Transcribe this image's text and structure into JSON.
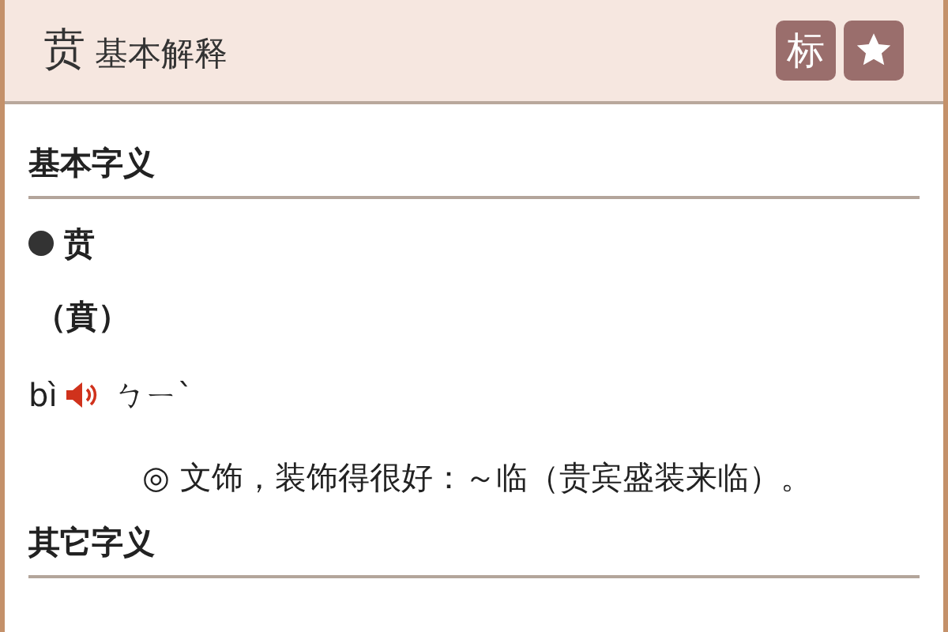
{
  "header": {
    "character": "贲",
    "title": "基本解释"
  },
  "header_buttons": [
    {
      "kind": "text",
      "label": "标"
    },
    {
      "kind": "star"
    }
  ],
  "sections": [
    {
      "heading": "基本字义",
      "entry": {
        "headword": "贲",
        "traditional": "（賁）",
        "pinyin": "bì",
        "zhuyin": "ㄅㄧˋ",
        "definitions": [
          "◎ 文饰，装饰得很好：～临（贵宾盛装来临）。"
        ]
      }
    },
    {
      "heading": "其它字义"
    }
  ]
}
